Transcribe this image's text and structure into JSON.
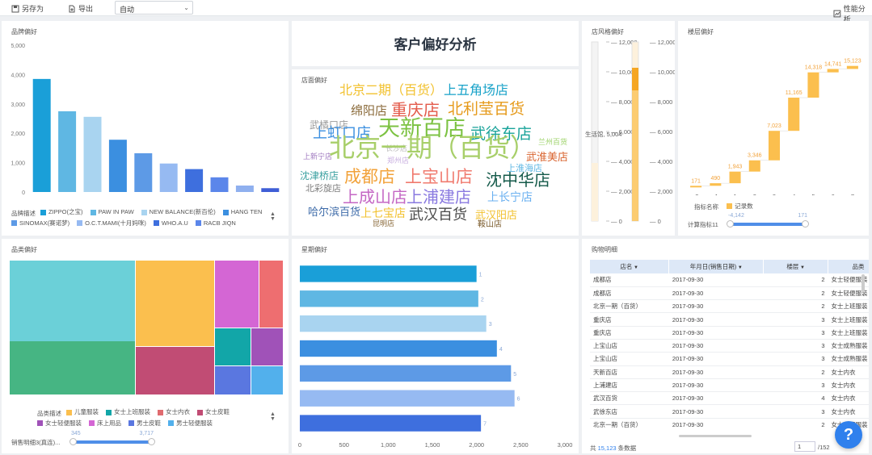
{
  "toolbar": {
    "save_as": "另存为",
    "export": "导出",
    "auto_select": "自动",
    "perf": "性能分析"
  },
  "dashboard_title": "客户偏好分析",
  "brand": {
    "title": "品牌偏好",
    "legend_label": "品牌描述",
    "chart_data": {
      "type": "bar",
      "categories": [
        "ZIPPO(之宝)",
        "PAW IN PAW",
        "NEW BALANCE(新百伦)",
        "HANG TEN",
        "SINOMAX(赛诺梦)",
        "O.C.T.MAMI(十月妈咪)",
        "WHO.A.U",
        "RACB JIQN",
        "",
        ""
      ],
      "values": [
        3850,
        2750,
        2560,
        1780,
        1320,
        970,
        780,
        500,
        220,
        130
      ],
      "colors": [
        "#1a9fd8",
        "#5fb7e3",
        "#a9d4f0",
        "#3b8fe0",
        "#5d9ae6",
        "#96baf2",
        "#3e6fde",
        "#5b86ea",
        "#8fb0ef",
        "#3f5ed6"
      ],
      "yticks": [
        0,
        1000,
        2000,
        3000,
        4000,
        5000
      ],
      "ytick_labels": [
        "0",
        "1,000",
        "2,000",
        "3,000",
        "4,000",
        "5,000"
      ],
      "ylim": [
        0,
        5000
      ]
    }
  },
  "store": {
    "title": "店面偏好",
    "words": [
      {
        "t": "北京二期（百货）",
        "c": "#f2c12e"
      },
      {
        "t": "上五角场店",
        "c": "#1aa3c9"
      },
      {
        "t": "重庆店",
        "c": "#e35a4a"
      },
      {
        "t": "北利莹百货",
        "c": "#e69a1a"
      },
      {
        "t": "绵阳店",
        "c": "#8a6a3a"
      },
      {
        "t": "武橘口店",
        "c": "#9b9b9b"
      },
      {
        "t": "上虹口店",
        "c": "#3b8fe0"
      },
      {
        "t": "天新百店",
        "c": "#7cc242"
      },
      {
        "t": "武徐东店",
        "c": "#19a39a"
      },
      {
        "t": "兰州百货",
        "c": "#9ed36a"
      },
      {
        "t": "上新宁店",
        "c": "#a07ac0"
      },
      {
        "t": "长沙店",
        "c": "#bbbbbb"
      },
      {
        "t": "北京一期（百货）",
        "c": "#a8cf6a"
      },
      {
        "t": "郑州店",
        "c": "#c9b0e0"
      },
      {
        "t": "武淮美店",
        "c": "#d9632e"
      },
      {
        "t": "上淮海店",
        "c": "#5fb7e3"
      },
      {
        "t": "沈津桥店",
        "c": "#3aa0a0"
      },
      {
        "t": "成都店",
        "c": "#f2a23a"
      },
      {
        "t": "上宝山店",
        "c": "#f07a6e"
      },
      {
        "t": "沈中华店",
        "c": "#155a4a"
      },
      {
        "t": "北彩旋店",
        "c": "#7d7d7d"
      },
      {
        "t": "上成山店",
        "c": "#c467c4"
      },
      {
        "t": "上浦建店",
        "c": "#8a7ae0"
      },
      {
        "t": "上长宁店",
        "c": "#6ab0f0"
      },
      {
        "t": "哈尔滨百货",
        "c": "#3c6aa8"
      },
      {
        "t": "上七宝店",
        "c": "#f2c12e"
      },
      {
        "t": "武汉百货",
        "c": "#4a4a4a"
      },
      {
        "t": "武汉阳店",
        "c": "#f2c12e"
      },
      {
        "t": "昆明店",
        "c": "#8a6a3a"
      },
      {
        "t": "鞍山店",
        "c": "#7a5a2a"
      }
    ]
  },
  "style": {
    "title": "店风格偏好",
    "axis_labels": [
      "12,000",
      "10,000",
      "8,000",
      "6,000",
      "4,000",
      "2,000",
      "0"
    ],
    "overlay_text": "生活馆, 5,004",
    "slider_level_fraction": 0.17
  },
  "floor": {
    "title": "楼层偏好",
    "chart_data": {
      "type": "bar",
      "categories": [
        "-2",
        "-1",
        "1",
        "2",
        "3",
        "4",
        "5",
        "6",
        "7"
      ],
      "values": [
        171,
        490,
        1943,
        3346,
        7023,
        11165,
        14318,
        14741,
        15123
      ],
      "value_labels": [
        "171",
        "490",
        "1,943",
        "3,346",
        "7,023",
        "11,165",
        "14,318",
        "14,741",
        "15,123"
      ],
      "ylim": [
        0,
        16500
      ]
    },
    "legend_label": "指标名称",
    "legend_item": "记录数",
    "range_label": "计算指标11",
    "range_min": "-4,142",
    "range_max": "171"
  },
  "category": {
    "title": "品类偏好",
    "legend_label": "品类描述",
    "legend": [
      {
        "name": "儿童服装",
        "color": "#fbbf4e"
      },
      {
        "name": "女士上班服装",
        "color": "#12a6a8"
      },
      {
        "name": "女士内衣",
        "color": "#e06b6f"
      },
      {
        "name": "女士皮鞋",
        "color": "#c14c74"
      },
      {
        "name": "女士轻便服装",
        "color": "#a052b8"
      },
      {
        "name": "床上用品",
        "color": "#d466d4"
      },
      {
        "name": "男士皮鞋",
        "color": "#5a77e0"
      },
      {
        "name": "男士轻便服装",
        "color": "#52b0ec"
      }
    ],
    "range_label": "销售明细3(真连)...",
    "range_min": "345",
    "range_max": "3,717"
  },
  "weekday": {
    "title": "星期偏好",
    "chart_data": {
      "type": "bar",
      "categories": [
        "1",
        "2",
        "3",
        "4",
        "5",
        "6",
        "7"
      ],
      "values": [
        2000,
        2020,
        2110,
        2230,
        2390,
        2430,
        2050
      ],
      "colors": [
        "#1a9fd8",
        "#5fb7e3",
        "#a9d4f0",
        "#3b8fe0",
        "#5d9ae6",
        "#96baf2",
        "#3e6fde"
      ],
      "xticks": [
        "0",
        "500",
        "1,000",
        "1,500",
        "2,000",
        "2,500",
        "3,000"
      ],
      "xlim": [
        0,
        3000
      ]
    }
  },
  "detail": {
    "title": "购物明细",
    "columns": [
      "店名",
      "年月日(销售日期)",
      "楼层",
      "品类"
    ],
    "rows": [
      [
        "成都店",
        "2017-09-30",
        "2",
        "女士轻便服装"
      ],
      [
        "成都店",
        "2017-09-30",
        "2",
        "女士轻便服装"
      ],
      [
        "北京一期（百货）",
        "2017-09-30",
        "2",
        "女士上班服装"
      ],
      [
        "重庆店",
        "2017-09-30",
        "3",
        "女士上班服装"
      ],
      [
        "重庆店",
        "2017-09-30",
        "3",
        "女士上班服装"
      ],
      [
        "上宝山店",
        "2017-09-30",
        "3",
        "女士成熟服装"
      ],
      [
        "上宝山店",
        "2017-09-30",
        "3",
        "女士成熟服装"
      ],
      [
        "天新百店",
        "2017-09-30",
        "2",
        "女士内衣"
      ],
      [
        "上浦建店",
        "2017-09-30",
        "3",
        "女士内衣"
      ],
      [
        "武汉百货",
        "2017-09-30",
        "4",
        "女士内衣"
      ],
      [
        "武徐东店",
        "2017-09-30",
        "3",
        "女士内衣"
      ],
      [
        "北京一期（百货）",
        "2017-09-30",
        "2",
        "女士上班服装"
      ]
    ],
    "footer_prefix": "共",
    "footer_count": "15,123",
    "footer_suffix": "条数据",
    "page_current": "1",
    "page_total": "/152"
  }
}
